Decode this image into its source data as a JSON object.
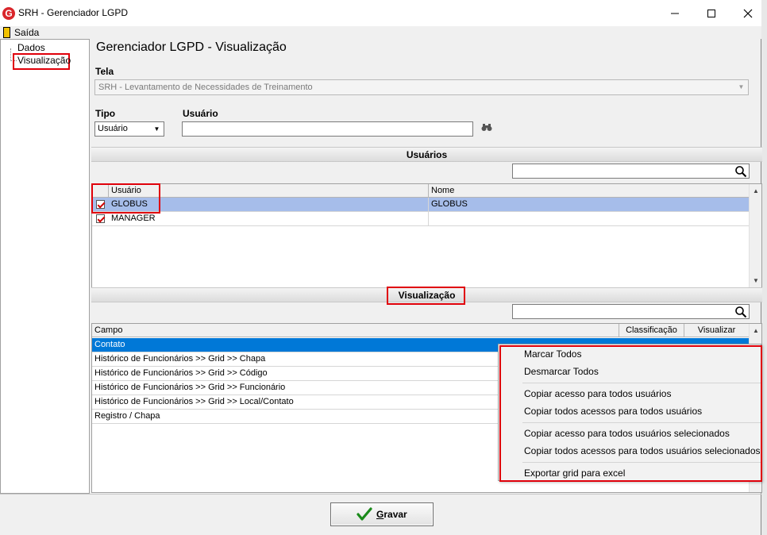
{
  "window": {
    "title": "SRH - Gerenciador LGPD",
    "logo_letter": "G"
  },
  "menu": {
    "exit_label": "Saída"
  },
  "tree": {
    "items": [
      {
        "label": "Dados"
      },
      {
        "label": "Visualização"
      }
    ]
  },
  "main": {
    "page_title": "Gerenciador LGPD - Visualização",
    "tela_label": "Tela",
    "tela_value": "SRH - Levantamento de Necessidades de Treinamento",
    "tipo_label": "Tipo",
    "tipo_value": "Usuário",
    "usuario_label": "Usuário",
    "usuario_value": ""
  },
  "users_section": {
    "title": "Usuários",
    "columns": [
      "Usuário",
      "Nome"
    ],
    "rows": [
      {
        "checked": true,
        "usuario": "GLOBUS",
        "nome": "GLOBUS",
        "selected": true
      },
      {
        "checked": true,
        "usuario": "MANAGER",
        "nome": "",
        "selected": false
      }
    ]
  },
  "visualizacao_section": {
    "title": "Visualização",
    "columns": [
      "Campo",
      "Classificação",
      "Visualizar"
    ],
    "rows": [
      {
        "campo": "Contato",
        "selected": true
      },
      {
        "campo": "Histórico de Funcionários >> Grid >> Chapa"
      },
      {
        "campo": "Histórico de Funcionários >> Grid >> Código"
      },
      {
        "campo": "Histórico de Funcionários >> Grid >> Funcionário"
      },
      {
        "campo": "Histórico de Funcionários >> Grid >> Local/Contato"
      },
      {
        "campo": "Registro / Chapa"
      }
    ]
  },
  "context_menu": {
    "items": [
      "Marcar Todos",
      "Desmarcar Todos",
      "Copiar acesso para todos usuários",
      "Copiar todos acessos para todos usuários",
      "Copiar acesso para todos usuários selecionados",
      "Copiar todos acessos para todos usuários selecionados",
      "Exportar grid para excel"
    ]
  },
  "footer": {
    "save_label": "Gravar"
  },
  "colors": {
    "selection_user_row": "#a6bdea",
    "selection_vis_row": "#0078d7",
    "highlight_red": "#e0000a",
    "check_green": "#1a8a1a"
  }
}
